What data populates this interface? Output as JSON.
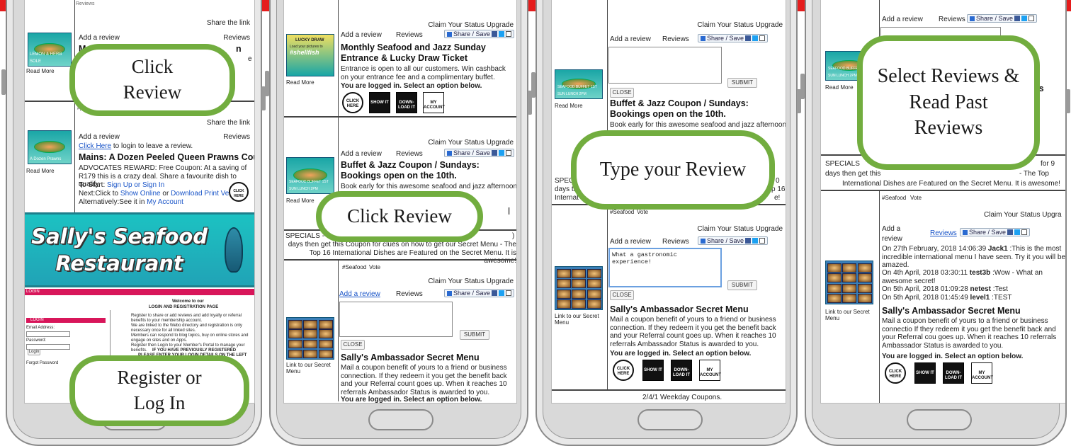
{
  "screen1": {
    "reviews_label_top": "Reviews",
    "share_link": "Share the link",
    "add_review": "Add a review",
    "reviews": "Reviews",
    "item1_title": "Mains",
    "item1_title_tail": "n",
    "item1_frag": "A",
    "item1_frag2": "e",
    "read_more": "Read More",
    "tag": "#p",
    "thumb1_label": "LEMON & HERB SOLE",
    "thumb2_label": "A Dozen Prawns",
    "share_link2": "Share the link",
    "add_review2": "Add a review",
    "reviews2": "Reviews",
    "click_here": "Click Here",
    "login_to_leave": " to login to leave a review.",
    "item2_title": "Mains: A Dozen Peeled Queen Prawns Coupon",
    "item2_desc": "ADVOCATES REWARD: Free Coupon: At a saving of R179 this is a crazy deal. Share a favourite dish to qualify.",
    "to_start": "To Start: ",
    "sign_up": "Sign Up or Sign In",
    "next_click": "Next:Click to ",
    "show_online": "Show Online",
    "or": " or ",
    "download_print": "Download Print Version",
    "alternatively": "Alternatively:See it in ",
    "my_account": "My Account",
    "read_more2": "Read More",
    "click_here_badge": "CLICK HERE",
    "banner_line1": "Sally's Seafood",
    "banner_line2": "Restaurant",
    "login_bar": "LOGIN",
    "welcome_line1": "Welcome to our",
    "welcome_line2": "LOGIN AND REGISTRATION PAGE",
    "bullets": [
      "Register to share or add reviews and add loyalty or referral benefits to your membership account.",
      "We are linked to the Webo directory and registration is only necessary once for all linked sites.",
      "Members can respond to blog topics, buy on online stores and engage on sites and on Apps.",
      "Register then Login to your Member's Portal to manage your benefits."
    ],
    "prev_registered": "IF YOU HAVE PREVIOUSLY REGISTERED",
    "please_enter": "PLEASE ENTER YOUR LOGIN DETAILS ON THE LEFT",
    "login_box_title": "LOGIN",
    "email_label": "Email Address:",
    "password_label": "Password:",
    "login_button": "Login",
    "forgot_password": "Forgot Password",
    "callout_top": "Click Review",
    "callout_bottom": "Register or Log In"
  },
  "screen2": {
    "lucky_draw": "LUCKY DRAW",
    "load_pictures": "Load your pictures to",
    "shellfish": "#shellfish",
    "read_more": "Read More",
    "claim": "Claim Your Status Upgrade",
    "add_review": "Add a review",
    "reviews": "Reviews",
    "share_save": "Share / Save",
    "item1_title": "Monthly Seafood and Jazz Sunday Entrance & Lucky Draw Ticket",
    "item1_desc": "Entrance is open to all our customers. Win cashback on your entrance fee and a complimentary buffet.",
    "logged_in": "You are logged in. Select an option below.",
    "icon_click": "CLICK HERE",
    "icon_show": "SHOW IT",
    "icon_download": "DOWN-LOAD IT",
    "icon_account": "MY ACCOUNT",
    "claim2": "Claim Your Status Upgrade",
    "add_review2": "Add a review",
    "reviews2": "Reviews",
    "share_save2": "Share / Save",
    "thumb2_label": "SEAFOOD BUFFET 1ST SUN LUNCH 2PM",
    "read_more2": "Read More",
    "item2_title": "Buffet & Jazz Coupon / Sundays: Bookings open on the 10th.",
    "item2_desc": "Book early for this awesome seafood and jazz afternoon",
    "frag_r": "r",
    "frag_l": "l",
    "specials": "SPECIALS - ",
    "specials_tail": ")",
    "specials_body": "days then get this Coupon for clues on how to get our Secret Menu - The Top 16 International Dishes are Featured on the Secret Menu. It is awesome!",
    "tag": "#Seafood",
    "vote": "Vote",
    "claim3": "Claim Your Status Upgrade",
    "add_review3": "Add a review",
    "reviews3": "Reviews",
    "share_save3": "Share / Save",
    "submit": "SUBMIT",
    "close": "CLOSE",
    "link_secret": "Link to our Secret Menu",
    "item3_title": "Sally's Ambassador Secret Menu",
    "item3_desc": "Mail a coupon benefit of yours to a friend or business connection. If they redeem it you get the benefit back and your Referral count goes up. When it reaches 10 referrals Ambassador Status is awarded to you.",
    "logged_in3": "You are logged in. Select an option below.",
    "callout": "Click Review"
  },
  "screen3": {
    "claim": "Claim Your Status Upgrade",
    "add_review": "Add a review",
    "reviews": "Reviews",
    "share_save": "Share / Save",
    "submit": "SUBMIT",
    "close": "CLOSE",
    "thumb_label": "SEAFOOD BUFFET 1ST SUN LUNCH 2PM",
    "read_more": "Read More",
    "item1_title": "Buffet & Jazz Coupon / Sundays: Bookings open on the 10th.",
    "item1_desc": "Book early for this awesome seafood and jazz afternoon",
    "spec": "SPEC",
    "days_th": "days th",
    "intern": "Internat",
    "frag_zero": "0",
    "frag_16": "p 16",
    "frag_bang": "e!",
    "tag": "#Seafood",
    "vote": "Vote",
    "claim2": "Claim Your Status Upgrade",
    "add_review2": "Add a review",
    "reviews2": "Reviews",
    "share_save2": "Share / Save",
    "review_text": "What a gastronomic experience!",
    "submit2": "SUBMIT",
    "close2": "CLOSE",
    "link_secret": "Link to our Secret Menu",
    "item2_title": "Sally's Ambassador Secret Menu",
    "item2_desc": "Mail a coupon benefit of yours to a friend or business connection. If they redeem it you get the benefit back and your Referral count goes up. When it reaches 10 referrals Ambassador Status is awarded to you.",
    "logged_in": "You are logged in. Select an option below.",
    "weekday": "2/4/1 Weekday Coupons.",
    "callout": "Type your Review"
  },
  "screen4": {
    "reviews_top": "Reviews",
    "add_review_top": "Add a review",
    "share_save_top": "Share / Save",
    "thumb_label": "SEAFOOD BUFFET 1ST SUN LUNCH 2PM",
    "read_more": "Read More",
    "frag_gs": "gs",
    "specials_frag": "SPECIALS",
    "for_frag": "for 9",
    "days_frag": "days then get this",
    "top_frag": "- The Top",
    "intl_line": "International Dishes are Featured on the Secret Menu. It is awesome!",
    "tag": "#Seafood",
    "vote": "Vote",
    "claim": "Claim Your Status Upgra",
    "add_a": "Add a",
    "review_word": "review",
    "reviews": "Reviews",
    "share_save": "Share / Save",
    "r1_date": "On 27th February, 2018 14:06:39",
    "r1_user": "Jack1",
    "r1_text": ":This is the most incredible international menu I have seen. Try it you will be amazed.",
    "r2_date": "On 4th April, 2018 03:30:11",
    "r2_user": "test3b",
    "r2_text": ":Wow - What an awesome secret!",
    "r3_date": "On 5th April, 2018 01:09:28",
    "r3_user": "netest",
    "r3_text": ":Test",
    "r4_date": "On 5th April, 2018 01:45:49",
    "r4_user": "level1",
    "r4_text": ":TEST",
    "link_secret": "Link to our Secret Menu",
    "item_title": "Sally's Ambassador Secret Menu",
    "item_desc": "Mail a coupon benefit of yours to a friend or business connectio If they redeem it you get the benefit back and your Referral cou goes up. When it reaches 10 referrals Ambassador Status is awarded to you.",
    "logged_in": "You are logged in. Select an option below.",
    "callout": "Select Reviews & Read Past Reviews"
  }
}
